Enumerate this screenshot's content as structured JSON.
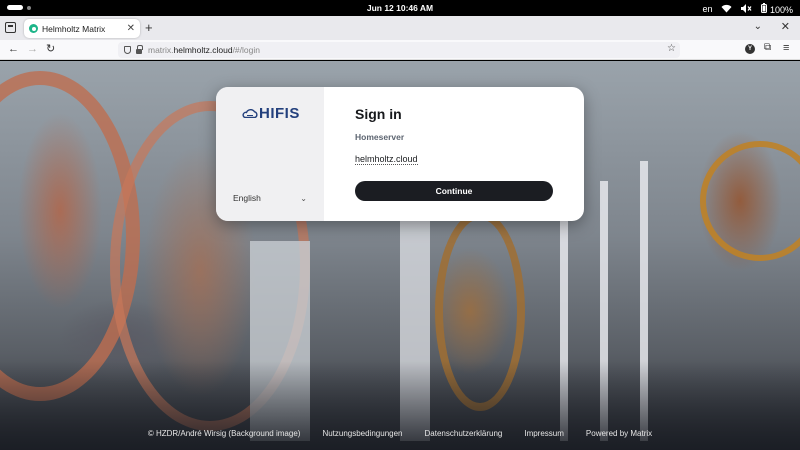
{
  "os_bar": {
    "clock": "Jun 12  10:46 AM",
    "keyboard_layout": "en",
    "battery": "100%"
  },
  "browser": {
    "tab_title": "Helmholtz Matrix",
    "url_prefix": "matrix.",
    "url_host": "helmholtz.cloud",
    "url_path": "/#/login",
    "favicon_color": "#1db589"
  },
  "login": {
    "logo_text": "HIFIS",
    "language": "English",
    "title": "Sign in",
    "homeserver_label": "Homeserver",
    "homeserver_value": "helmholtz.cloud",
    "continue_label": "Continue"
  },
  "footer": {
    "credit": "© HZDR/André Wirsig (Background image)",
    "terms": "Nutzungsbedingungen",
    "privacy": "Datenschutzerklärung",
    "imprint": "Impressum",
    "powered": "Powered by Matrix"
  },
  "colors": {
    "accent_dark": "#1b1d22",
    "logo_blue": "#23407d"
  }
}
